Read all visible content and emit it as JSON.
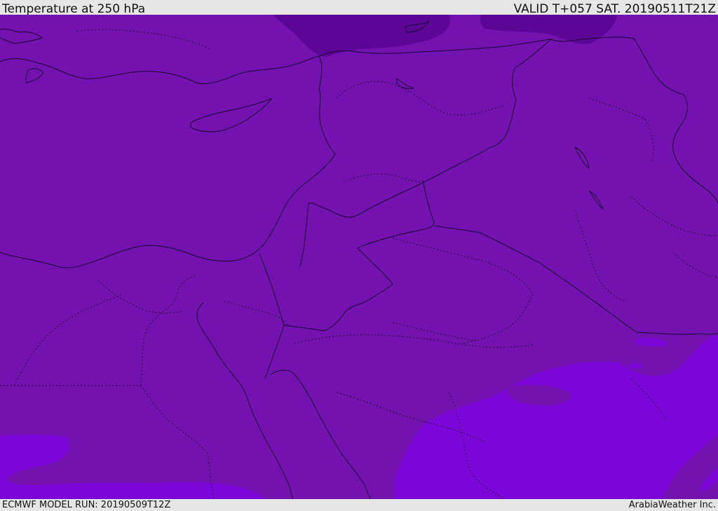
{
  "header": {
    "title": "Temperature at 250 hPa",
    "valid_time": "VALID T+057 SAT. 20190511T21Z"
  },
  "footer": {
    "model_run": "ECMWF MODEL RUN: 20190509T12Z",
    "credit": "ArabiaWeather Inc."
  },
  "map": {
    "colors": {
      "base_fill": "#7412b0",
      "cold_fill": "#5c0696",
      "warm_fill": "#7c06d8",
      "boundary": "#1a0030"
    }
  }
}
